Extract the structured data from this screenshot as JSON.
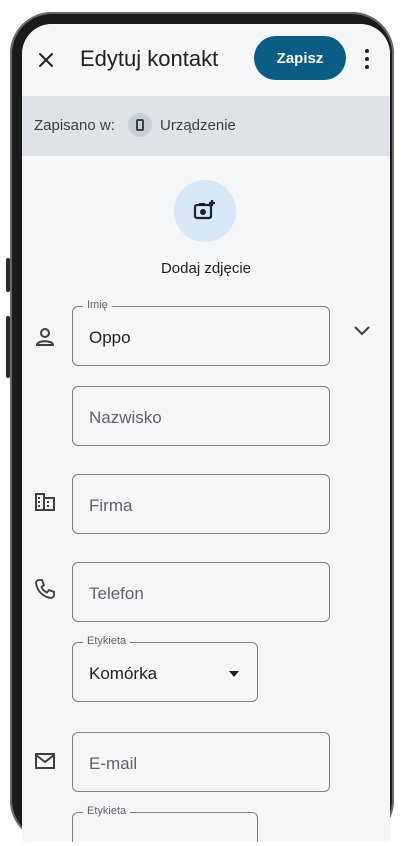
{
  "header": {
    "title": "Edytuj kontakt",
    "save_label": "Zapisz",
    "close_icon": "close-icon",
    "more_icon": "more-vert-icon"
  },
  "saved_in": {
    "label": "Zapisano w:",
    "device": "Urządzenie",
    "icon": "phone-icon"
  },
  "photo": {
    "label": "Dodaj zdjęcie",
    "icon": "add-photo-icon"
  },
  "form": {
    "name": {
      "label": "Imię",
      "value": "Oppo",
      "icon": "person-icon",
      "expand_icon": "chevron-down-icon"
    },
    "surname": {
      "placeholder": "Nazwisko"
    },
    "company": {
      "placeholder": "Firma",
      "icon": "building-icon"
    },
    "phone": {
      "placeholder": "Telefon",
      "icon": "phone-icon",
      "label_field": {
        "label": "Etykieta",
        "value": "Komórka"
      }
    },
    "email": {
      "placeholder": "E-mail",
      "icon": "mail-icon",
      "label_field": {
        "label": "Etykieta"
      }
    }
  },
  "colors": {
    "accent": "#0b5d86",
    "saved_bar": "#dfe3e8",
    "photo_circle": "#d6e7f5",
    "background": "#f5f6f8"
  }
}
